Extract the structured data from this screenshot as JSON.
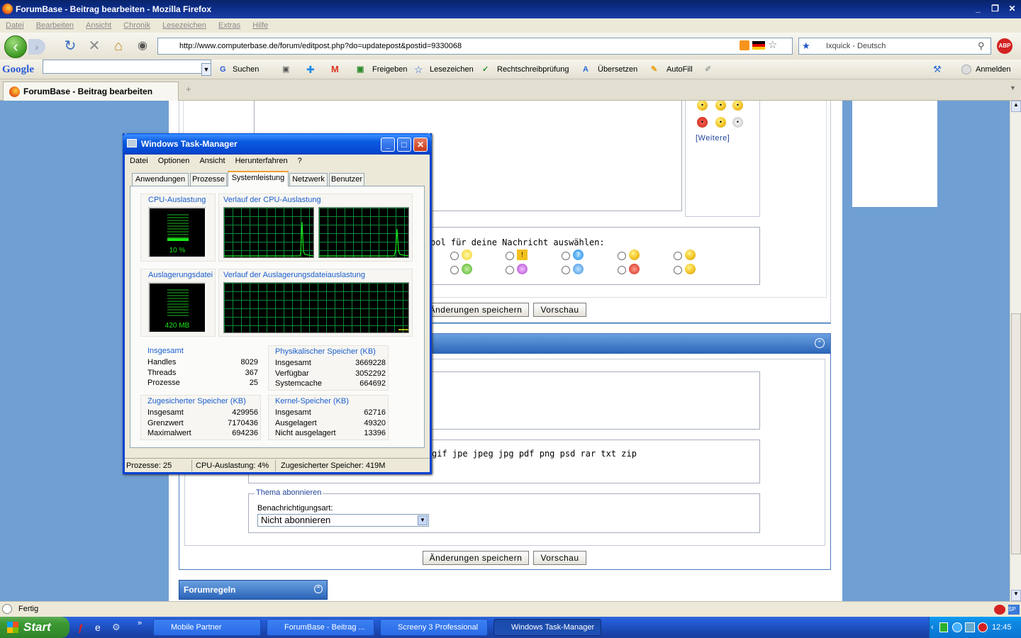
{
  "browser": {
    "window_title": "ForumBase - Beitrag bearbeiten - Mozilla Firefox",
    "menu": [
      "Datei",
      "Bearbeiten",
      "Ansicht",
      "Chronik",
      "Lesezeichen",
      "Extras",
      "Hilfe"
    ],
    "url": "http://www.computerbase.de/forum/editpost.php?do=updatepost&postid=9330068",
    "search_engine": "Ixquick - Deutsch",
    "abp": "ABP",
    "tab_title": "ForumBase - Beitrag bearbeiten",
    "status": "Fertig"
  },
  "google_toolbar": {
    "logo": "Google",
    "items": [
      "Suchen",
      "Freigeben",
      "Lesezeichen",
      "Rechtschreibprüfung",
      "Übersetzen",
      "AutoFill"
    ],
    "signin": "Anmelden"
  },
  "page": {
    "more_smilies": "[Weitere]",
    "icon_prompt": "bol für deine Nachricht auswählen:",
    "save_button": "Änderungen speichern",
    "preview_button": "Vorschau",
    "file_types": "gif jpe jpeg jpg pdf png psd rar txt zip",
    "subscribe_legend": "Thema abonnieren",
    "notify_label": "Benachrichtigungsart:",
    "notify_value": "Nicht abonnieren",
    "forum_rules": "Forumregeln"
  },
  "taskmgr": {
    "title": "Windows Task-Manager",
    "menu": [
      "Datei",
      "Optionen",
      "Ansicht",
      "Herunterfahren",
      "?"
    ],
    "tabs": [
      "Anwendungen",
      "Prozesse",
      "Systemleistung",
      "Netzwerk",
      "Benutzer"
    ],
    "active_tab": "Systemleistung",
    "cpu_title": "CPU-Auslastung",
    "cpu_value": "10 %",
    "cpu_history_title": "Verlauf der CPU-Auslastung",
    "pf_title": "Auslagerungsdatei",
    "pf_value": "420 MB",
    "pf_history_title": "Verlauf der Auslagerungsdateiauslastung",
    "totals": {
      "title": "Insgesamt",
      "rows": [
        [
          "Handles",
          "8029"
        ],
        [
          "Threads",
          "367"
        ],
        [
          "Prozesse",
          "25"
        ]
      ]
    },
    "physical": {
      "title": "Physikalischer Speicher (KB)",
      "rows": [
        [
          "Insgesamt",
          "3669228"
        ],
        [
          "Verfügbar",
          "3052292"
        ],
        [
          "Systemcache",
          "664692"
        ]
      ]
    },
    "commit": {
      "title": "Zugesicherter Speicher (KB)",
      "rows": [
        [
          "Insgesamt",
          "429956"
        ],
        [
          "Grenzwert",
          "7170436"
        ],
        [
          "Maximalwert",
          "694236"
        ]
      ]
    },
    "kernel": {
      "title": "Kernel-Speicher (KB)",
      "rows": [
        [
          "Insgesamt",
          "62716"
        ],
        [
          "Ausgelagert",
          "49320"
        ],
        [
          "Nicht ausgelagert",
          "13396"
        ]
      ]
    },
    "status": {
      "processes": "Prozesse: 25",
      "cpu": "CPU-Auslastung: 4%",
      "commit": "Zugesicherter Speicher: 419M"
    }
  },
  "taskbar": {
    "start": "Start",
    "tasks": [
      "Mobile Partner",
      "ForumBase - Beitrag ...",
      "Screeny 3 Professional",
      "Windows Task-Manager"
    ],
    "clock": "12:45"
  },
  "colors": {
    "xp_blue": "#0842d4",
    "graph_green": "#19e619",
    "page_bg": "#6f9fd3"
  }
}
